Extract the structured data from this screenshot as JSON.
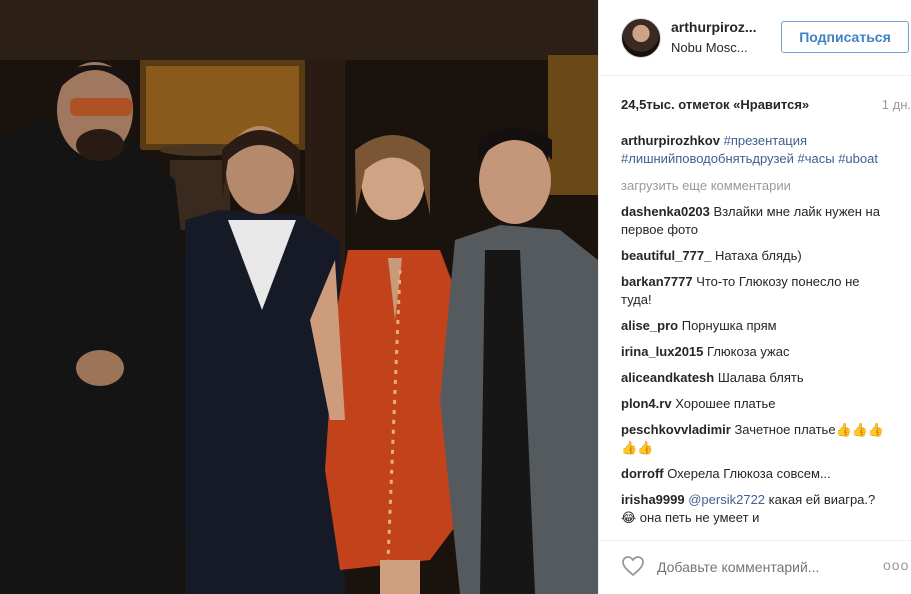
{
  "post": {
    "username": "arthurpiroz...",
    "location": "Nobu Mosc...",
    "follow_label": "Подписаться",
    "likes": "24,5тыс. отметок «Нравится»",
    "age": "1 дн.",
    "caption": {
      "user": "arthurpirozhkov",
      "tags": [
        "#презентация",
        "#лишнийповодобнятьдрузей",
        "#часы",
        "#uboat"
      ]
    },
    "load_more": "загрузить еще комментарии",
    "comments": [
      {
        "user": "dashenka0203",
        "text": "Взлайки мне лайк нужен на первое фото"
      },
      {
        "user": "beautiful_777_",
        "text": "Натаха блядь)"
      },
      {
        "user": "barkan7777",
        "text": "Что-то Глюкозу понесло не туда!"
      },
      {
        "user": "alise_pro",
        "text": "Порнушка прям"
      },
      {
        "user": "irina_lux2015",
        "text": "Глюкоза ужас"
      },
      {
        "user": "aliceandkatesh",
        "text": "Шалава блять"
      },
      {
        "user": "plon4.rv",
        "text": "Хорошее платье"
      },
      {
        "user": "peschkovvladimir",
        "text": "Зачетное платье👍👍👍👍👍"
      },
      {
        "user": "dorroff",
        "text": "Охерела Глюкоза совсем..."
      },
      {
        "user": "irisha9999",
        "mention": "@persik2722",
        "text": "какая ей виагра.? 😂 она петь не умеет и"
      }
    ],
    "add_comment_placeholder": "Добавьте комментарий...",
    "more_label": "ooo"
  },
  "icons": {
    "heart": "heart-outline-icon",
    "more": "more-options-icon"
  },
  "colors": {
    "follow": "#3f82c4",
    "tag": "#3f5f91",
    "muted": "#999999"
  }
}
